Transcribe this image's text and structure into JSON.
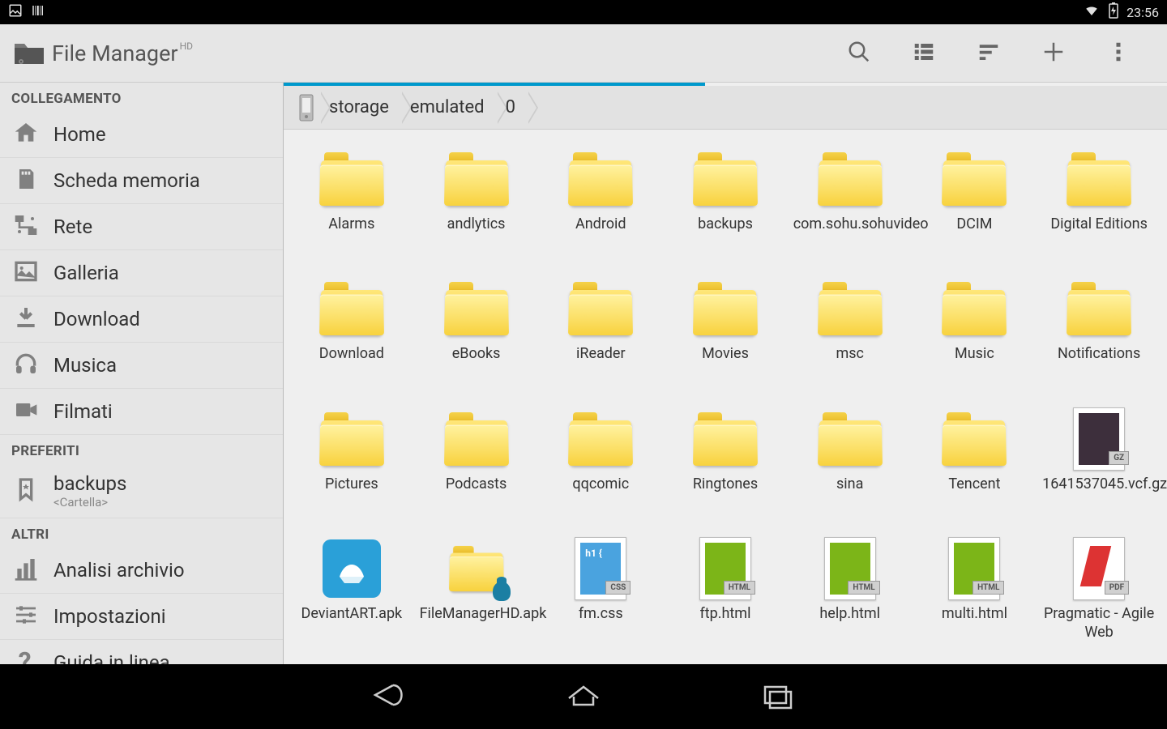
{
  "statusbar": {
    "time": "23:56"
  },
  "app": {
    "title": "File Manager",
    "suffix": "HD"
  },
  "sidebar": {
    "sections": {
      "collegamento": "COLLEGAMENTO",
      "preferiti": "PREFERITI",
      "altri": "ALTRI"
    },
    "home": "Home",
    "sdcard": "Scheda memoria",
    "network": "Rete",
    "gallery": "Galleria",
    "download": "Download",
    "music": "Musica",
    "video": "Filmati",
    "fav_backups": "backups",
    "fav_backups_sub": "<Cartella>",
    "analysis": "Analisi archivio",
    "settings": "Impostazioni",
    "help": "Guida in linea"
  },
  "breadcrumb": {
    "p1": "storage",
    "p2": "emulated",
    "p3": "0"
  },
  "items": [
    {
      "name": "Alarms",
      "type": "folder"
    },
    {
      "name": "andlytics",
      "type": "folder"
    },
    {
      "name": "Android",
      "type": "folder"
    },
    {
      "name": "backups",
      "type": "folder"
    },
    {
      "name": "com.sohu.sohuvideo",
      "type": "folder"
    },
    {
      "name": "DCIM",
      "type": "folder"
    },
    {
      "name": "Digital Editions",
      "type": "folder"
    },
    {
      "name": "Download",
      "type": "folder"
    },
    {
      "name": "eBooks",
      "type": "folder"
    },
    {
      "name": "iReader",
      "type": "folder"
    },
    {
      "name": "Movies",
      "type": "folder"
    },
    {
      "name": "msc",
      "type": "folder"
    },
    {
      "name": "Music",
      "type": "folder"
    },
    {
      "name": "Notifications",
      "type": "folder"
    },
    {
      "name": "Pictures",
      "type": "folder"
    },
    {
      "name": "Podcasts",
      "type": "folder"
    },
    {
      "name": "qqcomic",
      "type": "folder"
    },
    {
      "name": "Ringtones",
      "type": "folder"
    },
    {
      "name": "sina",
      "type": "folder"
    },
    {
      "name": "Tencent",
      "type": "folder"
    },
    {
      "name": "1641537045.vcf.gz",
      "type": "gz",
      "badge": "GZ"
    },
    {
      "name": "DeviantART.apk",
      "type": "apk-da"
    },
    {
      "name": "FileManagerHD.apk",
      "type": "apk-fm"
    },
    {
      "name": "fm.css",
      "type": "css",
      "badge": "CSS",
      "text": "h1 {"
    },
    {
      "name": "ftp.html",
      "type": "html",
      "badge": "HTML",
      "text": "</>"
    },
    {
      "name": "help.html",
      "type": "html",
      "badge": "HTML",
      "text": "</>"
    },
    {
      "name": "multi.html",
      "type": "html",
      "badge": "HTML",
      "text": "</>"
    },
    {
      "name": "Pragmatic - Agile Web",
      "type": "pdf",
      "badge": "PDF"
    }
  ]
}
